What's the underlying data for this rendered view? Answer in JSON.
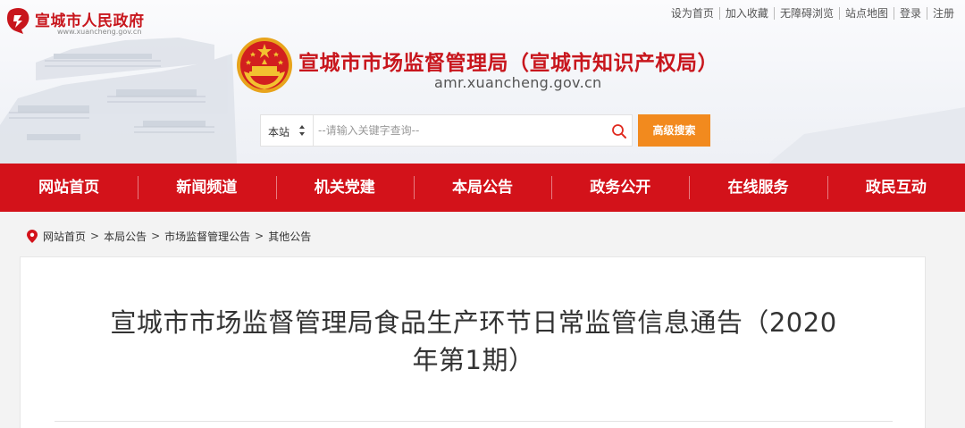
{
  "portal": {
    "title": "宣城市人民政府",
    "url": "www.xuancheng.gov.cn"
  },
  "top_links": [
    "设为首页",
    "加入收藏",
    "无障碍浏览",
    "站点地图",
    "登录",
    "注册"
  ],
  "bureau": {
    "title": "宣城市市场监督管理局（宣城市知识产权局）",
    "domain": "amr.xuancheng.gov.cn"
  },
  "search": {
    "scope": "本站",
    "placeholder": "--请输入关键字查询--",
    "value": "",
    "advanced_label": "高级搜索"
  },
  "nav": {
    "items": [
      "网站首页",
      "新闻频道",
      "机关党建",
      "本局公告",
      "政务公开",
      "在线服务",
      "政民互动"
    ]
  },
  "breadcrumb": {
    "items": [
      "网站首页",
      "本局公告",
      "市场监督管理公告",
      "其他公告"
    ],
    "separator": ">"
  },
  "article": {
    "title": "宣城市市场监督管理局食品生产环节日常监管信息通告（2020年第1期）"
  },
  "colors": {
    "brand_red": "#d3121a",
    "title_red": "#c8161d",
    "accent_orange": "#f28a1e"
  },
  "icons": [
    "portal-seal-icon",
    "national-emblem-icon",
    "search-icon",
    "location-pin-icon",
    "up-down-arrows-icon"
  ]
}
